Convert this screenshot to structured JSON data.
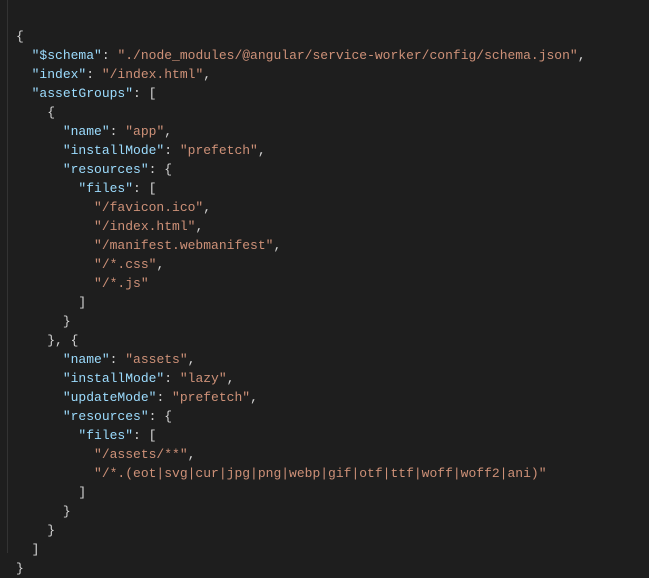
{
  "json_content": {
    "schema_key": "\"$schema\"",
    "schema_value": "\"./node_modules/@angular/service-worker/config/schema.json\"",
    "index_key": "\"index\"",
    "index_value": "\"/index.html\"",
    "assetGroups_key": "\"assetGroups\"",
    "group1": {
      "name_key": "\"name\"",
      "name_value": "\"app\"",
      "installMode_key": "\"installMode\"",
      "installMode_value": "\"prefetch\"",
      "resources_key": "\"resources\"",
      "files_key": "\"files\"",
      "files": [
        "\"/favicon.ico\"",
        "\"/index.html\"",
        "\"/manifest.webmanifest\"",
        "\"/*.css\"",
        "\"/*.js\""
      ]
    },
    "group2": {
      "name_key": "\"name\"",
      "name_value": "\"assets\"",
      "installMode_key": "\"installMode\"",
      "installMode_value": "\"lazy\"",
      "updateMode_key": "\"updateMode\"",
      "updateMode_value": "\"prefetch\"",
      "resources_key": "\"resources\"",
      "files_key": "\"files\"",
      "files": [
        "\"/assets/**\"",
        "\"/*.(eot|svg|cur|jpg|png|webp|gif|otf|ttf|woff|woff2|ani)\""
      ]
    }
  }
}
